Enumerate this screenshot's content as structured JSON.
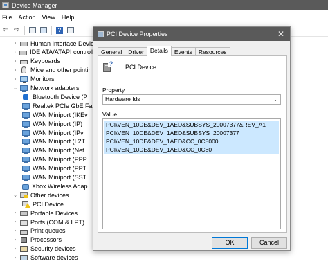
{
  "window": {
    "title": "Device Manager"
  },
  "menu": [
    {
      "id": "file",
      "label": "File"
    },
    {
      "id": "action",
      "label": "Action"
    },
    {
      "id": "view",
      "label": "View"
    },
    {
      "id": "help",
      "label": "Help"
    }
  ],
  "tree": {
    "items": [
      {
        "label": "Human Interface Devic",
        "expander": "›",
        "icon": "hid-icon"
      },
      {
        "label": "IDE ATA/ATAPI controlle",
        "expander": "›",
        "icon": "ide-controller-icon"
      },
      {
        "label": "Keyboards",
        "expander": "›",
        "icon": "keyboard-icon"
      },
      {
        "label": "Mice and other pointin",
        "expander": "›",
        "icon": "mouse-icon"
      },
      {
        "label": "Monitors",
        "expander": "›",
        "icon": "monitor-icon"
      },
      {
        "label": "Network adapters",
        "expander": "⌄",
        "icon": "network-adapter-icon"
      },
      {
        "label": "Bluetooth Device (P",
        "expander": "",
        "icon": "bluetooth-icon"
      },
      {
        "label": "Realtek PCIe GbE Fa",
        "expander": "",
        "icon": "network-adapter-icon"
      },
      {
        "label": "WAN Miniport (IKEv",
        "expander": "",
        "icon": "network-adapter-icon"
      },
      {
        "label": "WAN Miniport (IP)",
        "expander": "",
        "icon": "network-adapter-icon"
      },
      {
        "label": "WAN Miniport (IPv",
        "expander": "",
        "icon": "network-adapter-icon"
      },
      {
        "label": "WAN Miniport (L2T",
        "expander": "",
        "icon": "network-adapter-icon"
      },
      {
        "label": "WAN Miniport (Net",
        "expander": "",
        "icon": "network-adapter-icon"
      },
      {
        "label": "WAN Miniport (PPP",
        "expander": "",
        "icon": "network-adapter-icon"
      },
      {
        "label": "WAN Miniport (PPT",
        "expander": "",
        "icon": "network-adapter-icon"
      },
      {
        "label": "WAN Miniport (SST",
        "expander": "",
        "icon": "network-adapter-icon"
      },
      {
        "label": "Xbox Wireless Adap",
        "expander": "",
        "icon": "xbox-adapter-icon"
      },
      {
        "label": "Other devices",
        "expander": "⌄",
        "icon": "other-devices-icon"
      },
      {
        "label": "PCI Device",
        "expander": "",
        "icon": "warning-device-icon"
      },
      {
        "label": "Portable Devices",
        "expander": "›",
        "icon": "portable-device-icon"
      },
      {
        "label": "Ports (COM & LPT)",
        "expander": "›",
        "icon": "port-icon"
      },
      {
        "label": "Print queues",
        "expander": "›",
        "icon": "printer-icon"
      },
      {
        "label": "Processors",
        "expander": "›",
        "icon": "processor-icon"
      },
      {
        "label": "Security devices",
        "expander": "›",
        "icon": "security-device-icon"
      },
      {
        "label": "Software devices",
        "expander": "›",
        "icon": "software-device-icon"
      }
    ]
  },
  "dialog": {
    "title": "PCI Device Properties",
    "close_glyph": "✕",
    "tabs": [
      {
        "id": "general",
        "label": "General"
      },
      {
        "id": "driver",
        "label": "Driver"
      },
      {
        "id": "details",
        "label": "Details",
        "active": true
      },
      {
        "id": "events",
        "label": "Events"
      },
      {
        "id": "resources",
        "label": "Resources"
      }
    ],
    "device_name": "PCI Device",
    "property_label": "Property",
    "property_value": "Hardware Ids",
    "value_label": "Value",
    "values": [
      "PCI\\VEN_10DE&DEV_1AED&SUBSYS_20007377&REV_A1",
      "PCI\\VEN_10DE&DEV_1AED&SUBSYS_20007377",
      "PCI\\VEN_10DE&DEV_1AED&CC_0C8000",
      "PCI\\VEN_10DE&DEV_1AED&CC_0C80"
    ],
    "ok_label": "OK",
    "cancel_label": "Cancel"
  },
  "colors": {
    "titlebar": "#5a5a5a",
    "selection": "#cce8ff",
    "accent": "#0078d7"
  }
}
